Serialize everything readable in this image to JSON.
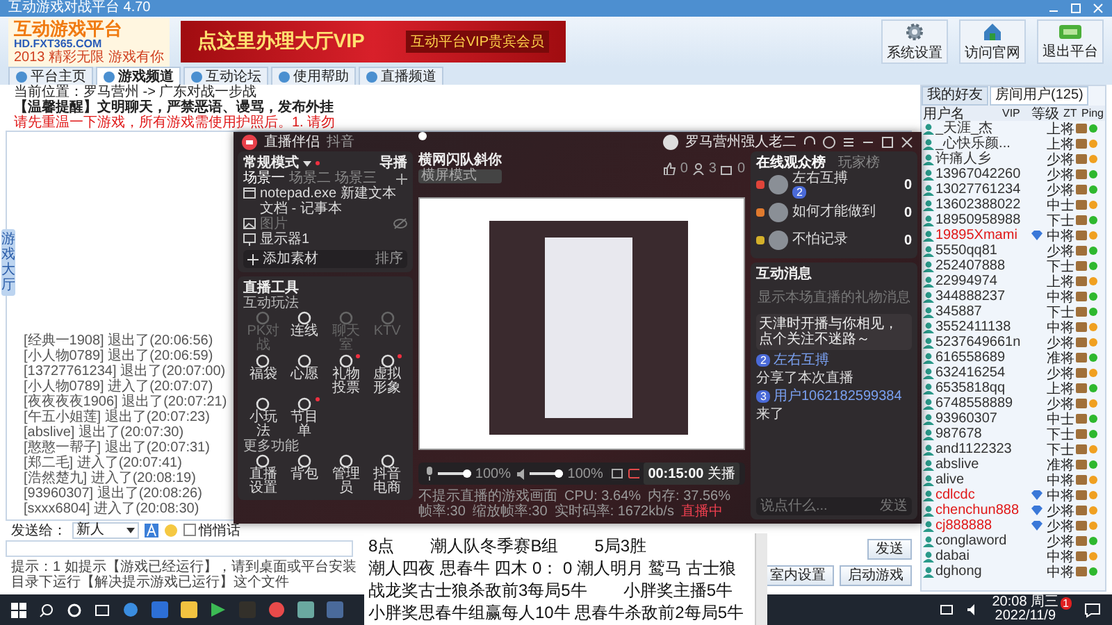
{
  "window": {
    "title": "互动游戏对战平台 4.70"
  },
  "logo": {
    "name": "互动游戏平台",
    "site": "HD.FXT365.COM",
    "slogan": "2013 精彩无限 游戏有你"
  },
  "banner": {
    "text": "点这里办理大厅VIP",
    "badge": "互动平台VIP贵宾会员"
  },
  "toolbar": [
    {
      "label": "系统设置",
      "kind": "gear"
    },
    {
      "label": "访问官网",
      "kind": "house"
    },
    {
      "label": "退出平台",
      "kind": "exit"
    }
  ],
  "tabs": [
    {
      "label": "平台主页",
      "selected": false
    },
    {
      "label": "游戏频道",
      "selected": true
    },
    {
      "label": "互动论坛",
      "selected": false
    },
    {
      "label": "使用帮助",
      "selected": false
    },
    {
      "label": "直播频道",
      "selected": false
    }
  ],
  "location": "当前位置：罗马营州 -> 广东对战一步战",
  "notice": "【温馨提醒】文明聊天，严禁恶语、谩骂，发布外挂",
  "alert": "请先重温一下游戏，所有游戏需使用护照后。1. 请勿",
  "side_tab": "游戏大厅",
  "log": [
    "[经典一1908] 退出了(20:06:56)",
    "[小人物0789] 退出了(20:06:59)",
    "[13727761234] 退出了(20:07:00)",
    "[小人物0789] 进入了(20:07:07)",
    "[夜夜夜夜1906] 退出了(20:07:21)",
    "[午五小姐莲] 退出了(20:07:23)",
    "[abslive] 退出了(20:07:30)",
    "[憨憨一帮子] 退出了(20:07:31)",
    "[郑二毛] 进入了(20:07:41)",
    "[浩然楚九] 进入了(20:08:19)",
    "[93960307] 退出了(20:08:26)",
    "[sxxx6804] 进入了(20:08:30)"
  ],
  "send": {
    "label": "发送给：",
    "target": "新人",
    "whisper_label": "悄悄话",
    "whisper": false,
    "button": "发送"
  },
  "tip": "提示：1 如提示【游戏已经运行】，请到桌面或平台安装目录下运行【解决提示游戏已运行】这个文件",
  "actions": [
    "室内设置",
    "启动游戏"
  ],
  "user_panel": {
    "tabs": [
      {
        "label": "我的好友",
        "selected": false
      },
      {
        "label": "房间用户(125)",
        "selected": true
      }
    ],
    "columns": [
      "用户名",
      "VIP",
      "等级",
      "ZT",
      "Ping"
    ],
    "users": [
      {
        "name": "_天涯_杰",
        "vip": false,
        "level": "上将",
        "color": "#2eb82e"
      },
      {
        "name": "_心快乐颜...",
        "vip": false,
        "level": "上将",
        "color": "#f0a020"
      },
      {
        "name": "许痛人乡",
        "vip": false,
        "level": "少将",
        "color": "#f0a020"
      },
      {
        "name": "13967042260",
        "vip": false,
        "level": "少将",
        "color": "#2eb82e"
      },
      {
        "name": "13027761234",
        "vip": false,
        "level": "少将",
        "color": "#2eb82e"
      },
      {
        "name": "13602388022",
        "vip": false,
        "level": "中士",
        "color": "#f0a020"
      },
      {
        "name": "18950958988",
        "vip": false,
        "level": "下士",
        "color": "#2eb82e"
      },
      {
        "name": "19895Xmami",
        "vip": true,
        "level": "中将",
        "color": "#f0a020"
      },
      {
        "name": "5550qq81",
        "vip": false,
        "level": "少将",
        "color": "#2eb82e"
      },
      {
        "name": "252407888",
        "vip": false,
        "level": "下士",
        "color": "#2eb82e"
      },
      {
        "name": "22994974",
        "vip": false,
        "level": "上将",
        "color": "#f0a020"
      },
      {
        "name": "344888237",
        "vip": false,
        "level": "中将",
        "color": "#2eb82e"
      },
      {
        "name": "345887",
        "vip": false,
        "level": "下士",
        "color": "#2eb82e"
      },
      {
        "name": "3552411138",
        "vip": false,
        "level": "中将",
        "color": "#f0a020"
      },
      {
        "name": "5237649661n",
        "vip": false,
        "level": "少将",
        "color": "#f0a020"
      },
      {
        "name": "616558689",
        "vip": false,
        "level": "准将",
        "color": "#2eb82e"
      },
      {
        "name": "632416254",
        "vip": false,
        "level": "少将",
        "color": "#f0a020"
      },
      {
        "name": "6535818qq",
        "vip": false,
        "level": "上将",
        "color": "#2eb82e"
      },
      {
        "name": "6748558889",
        "vip": false,
        "level": "少将",
        "color": "#f0a020"
      },
      {
        "name": "93960307",
        "vip": false,
        "level": "中士",
        "color": "#2eb82e"
      },
      {
        "name": "987678",
        "vip": false,
        "level": "下士",
        "color": "#2eb82e"
      },
      {
        "name": "and1122323",
        "vip": false,
        "level": "下士",
        "color": "#f0a020"
      },
      {
        "name": "abslive",
        "vip": false,
        "level": "准将",
        "color": "#2eb82e"
      },
      {
        "name": "alive",
        "vip": false,
        "level": "中将",
        "color": "#f0a020"
      },
      {
        "name": "cdlcdc",
        "vip": true,
        "level": "中将",
        "color": "#f0a020"
      },
      {
        "name": "chenchun888",
        "vip": true,
        "level": "少将",
        "color": "#f0a020"
      },
      {
        "name": "cj888888",
        "vip": true,
        "level": "少将",
        "color": "#f0a020"
      },
      {
        "name": "conglaword",
        "vip": false,
        "level": "少将",
        "color": "#2eb82e"
      },
      {
        "name": "dabai",
        "vip": false,
        "level": "中将",
        "color": "#f0a020"
      },
      {
        "name": "dghong",
        "vip": false,
        "level": "中将",
        "color": "#2eb82e"
      }
    ]
  },
  "stream": {
    "title": "直播伴侣",
    "platform": "抖音",
    "user": "罗马营州强人老二",
    "mode": "常规模式",
    "director": "导播",
    "scenes": [
      {
        "label": "场景一",
        "selected": true
      },
      {
        "label": "场景二",
        "selected": false
      },
      {
        "label": "场景三",
        "selected": false
      }
    ],
    "sources": [
      {
        "label": "notepad.exe 新建文本文档 - 记事本",
        "kind": "window",
        "hidden": false
      },
      {
        "label": "图片",
        "kind": "image",
        "hidden": true
      },
      {
        "label": "显示器1",
        "kind": "monitor",
        "hidden": false
      }
    ],
    "add_source": "添加素材",
    "sort": "排序",
    "tools_title": "直播工具",
    "interactive_title": "互动玩法",
    "interactive": [
      {
        "label": "PK对战",
        "disabled": true,
        "badge": false
      },
      {
        "label": "连线",
        "disabled": false,
        "badge": false
      },
      {
        "label": "聊天室",
        "disabled": true,
        "badge": false
      },
      {
        "label": "KTV",
        "disabled": true,
        "badge": false
      },
      {
        "label": "福袋",
        "disabled": false,
        "badge": false
      },
      {
        "label": "心愿",
        "disabled": false,
        "badge": false
      },
      {
        "label": "礼物投票",
        "disabled": false,
        "badge": true
      },
      {
        "label": "虚拟形象",
        "disabled": false,
        "badge": true
      },
      {
        "label": "小玩法",
        "disabled": false,
        "badge": false
      },
      {
        "label": "节目单",
        "disabled": false,
        "badge": true
      }
    ],
    "more_title": "更多功能",
    "more": [
      {
        "label": "直播设置",
        "disabled": false,
        "badge": false
      },
      {
        "label": "背包",
        "disabled": false,
        "badge": false
      },
      {
        "label": "管理员",
        "disabled": false,
        "badge": false
      },
      {
        "label": "抖音电商",
        "disabled": false,
        "badge": false
      }
    ],
    "room": {
      "name": "横网闪队斜你",
      "orientation": "横屏模式",
      "likes": "0",
      "viewers": "3",
      "gifts": "0"
    },
    "volume": [
      {
        "level": 1,
        "reading": "100%"
      },
      {
        "level": 1,
        "reading": "100%"
      }
    ],
    "timer": "00:15:00",
    "stop": "关播",
    "hint": "不提示直播的游戏画面",
    "stats": [
      "CPU: 3.64%",
      "内存: 37.56%",
      "帧率:30",
      "缩放帧率:30",
      "实时码率: 1672kb/s"
    ],
    "status": "直播中",
    "audience_tabs": [
      {
        "label": "在线观众榜",
        "selected": true
      },
      {
        "label": "玩家榜",
        "selected": false
      }
    ],
    "audience": [
      {
        "name": "左右互搏",
        "badge": "2",
        "score": "0",
        "color": "#e0443a"
      },
      {
        "name": "如何才能做到",
        "score": "0",
        "color": "#e07a2e"
      },
      {
        "name": "不怕记录",
        "score": "0",
        "color": "#d4b02a"
      }
    ],
    "messages_title": "互动消息",
    "messages_hint": "显示本场直播的礼物消息",
    "messages": [
      {
        "kind": "notice",
        "text": "天津时开播与你相见，点个关注不迷路～"
      },
      {
        "kind": "event",
        "badge": "2",
        "user": "左右互搏",
        "text": "分享了本次直播"
      },
      {
        "kind": "event",
        "badge": "3",
        "user": "用户1062182599384",
        "text": "来了"
      }
    ],
    "input_placeholder": "说点什么...",
    "send": "发送"
  },
  "notepad": {
    "lines": [
      [
        "8点",
        "潮人队冬季赛B组",
        "5局3胜"
      ],
      [
        "潮人四夜 思春牛 四木 0： 0 潮人明月 鹫马 古士狼"
      ],
      [
        "战龙奖古士狼杀敌前3每局5牛",
        "小胖奖主播5牛"
      ],
      [
        "小胖奖思春牛组赢每人10牛 思春牛杀敌前2每局5牛"
      ]
    ]
  },
  "taskbar": {
    "time": "20:08 周三",
    "date": "2022/11/9",
    "notification_count": "1"
  }
}
